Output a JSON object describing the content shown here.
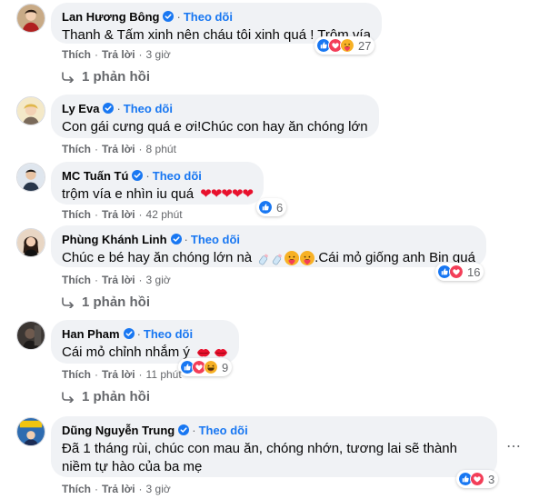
{
  "follow_label": "Theo dõi",
  "like_label": "Thích",
  "reply_label": "Trả lời",
  "comments": [
    {
      "name": "Lan Hương Bông",
      "text": "Thanh & Tấm xinh nên cháu tôi xinh quá ! Trộm vía",
      "reaction_count": "27",
      "time": "3 giờ",
      "replies": "1 phản hồi"
    },
    {
      "name": "Ly Eva",
      "text": "Con gái cưng quá e ơi!Chúc con hay ăn chóng lớn",
      "time": "8 phút"
    },
    {
      "name": "MC Tuấn Tú",
      "text": "trộm vía e nhìn iu quá",
      "emoji": "❤❤❤❤❤",
      "reaction_count": "6",
      "time": "42 phút"
    },
    {
      "name": "Phùng Khánh Linh",
      "text_before": "Chúc e bé hay ăn chóng lớn nà",
      "text_after": ".Cái mỏ giống anh Bin quá",
      "reaction_count": "16",
      "time": "3 giờ",
      "replies": "1 phản hồi"
    },
    {
      "name": "Han Pham",
      "text": "Cái mỏ chỉnh nhắm ý",
      "reaction_count": "9",
      "time": "11 phút",
      "replies": "1 phản hồi"
    },
    {
      "name": "Dũng Nguyễn Trung",
      "text": "Đã 1 tháng rùi, chúc con mau ăn, chóng nhớn, tương lai sẽ thành niềm tự hào của ba mẹ",
      "reaction_count": "3",
      "time": "3 giờ"
    }
  ],
  "colors": {
    "bubble": "#f0f2f5",
    "follow": "#1877f2",
    "meta": "#65676b",
    "like": "#1877f2",
    "love": "#f33e58",
    "haha": "#f7b125"
  },
  "icons": {
    "verified": "verified-badge-icon",
    "like": "like-reaction-icon",
    "love": "love-reaction-icon",
    "haha": "haha-reaction-icon",
    "care": "care-reaction-icon",
    "reply_arrow": "reply-arrow-icon",
    "more": "more-options-icon"
  }
}
